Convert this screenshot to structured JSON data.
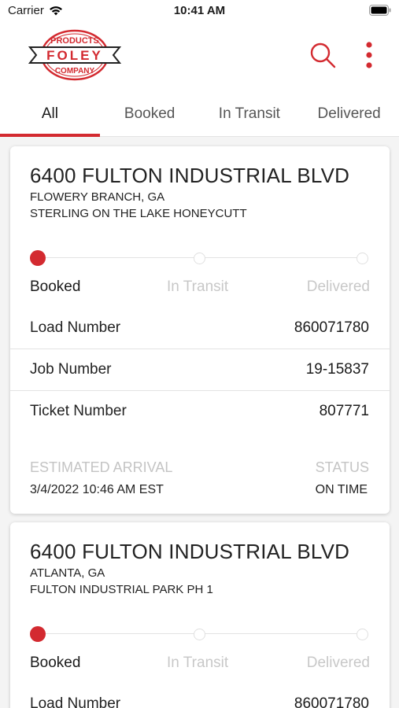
{
  "status_bar": {
    "carrier": "Carrier",
    "time": "10:41 AM"
  },
  "brand": {
    "line1": "PRODUCTS",
    "line2": "FOLEY",
    "line3": "COMPANY",
    "accent": "#d32a30"
  },
  "header": {
    "search_icon": "search-icon",
    "more_icon": "more-vertical-icon"
  },
  "tabs": [
    {
      "label": "All",
      "active": true
    },
    {
      "label": "Booked",
      "active": false
    },
    {
      "label": "In Transit",
      "active": false
    },
    {
      "label": "Delivered",
      "active": false
    }
  ],
  "progress_steps": [
    "Booked",
    "In Transit",
    "Delivered"
  ],
  "labels": {
    "load_number": "Load Number",
    "job_number": "Job Number",
    "ticket_number": "Ticket Number",
    "estimated_arrival": "ESTIMATED ARRIVAL",
    "status": "STATUS"
  },
  "deliveries": [
    {
      "address": "6400 FULTON INDUSTRIAL BLVD",
      "city": "FLOWERY BRANCH, GA",
      "project": "STERLING ON THE LAKE HONEYCUTT",
      "current_step": "Booked",
      "load_number": "860071780",
      "job_number": "19-15837",
      "ticket_number": "807771",
      "estimated_arrival": "3/4/2022 10:46 AM EST",
      "status": "ON TIME"
    },
    {
      "address": "6400 FULTON INDUSTRIAL BLVD",
      "city": "ATLANTA, GA",
      "project": "FULTON INDUSTRIAL PARK PH 1",
      "current_step": "Booked",
      "load_number": "860071780"
    }
  ]
}
